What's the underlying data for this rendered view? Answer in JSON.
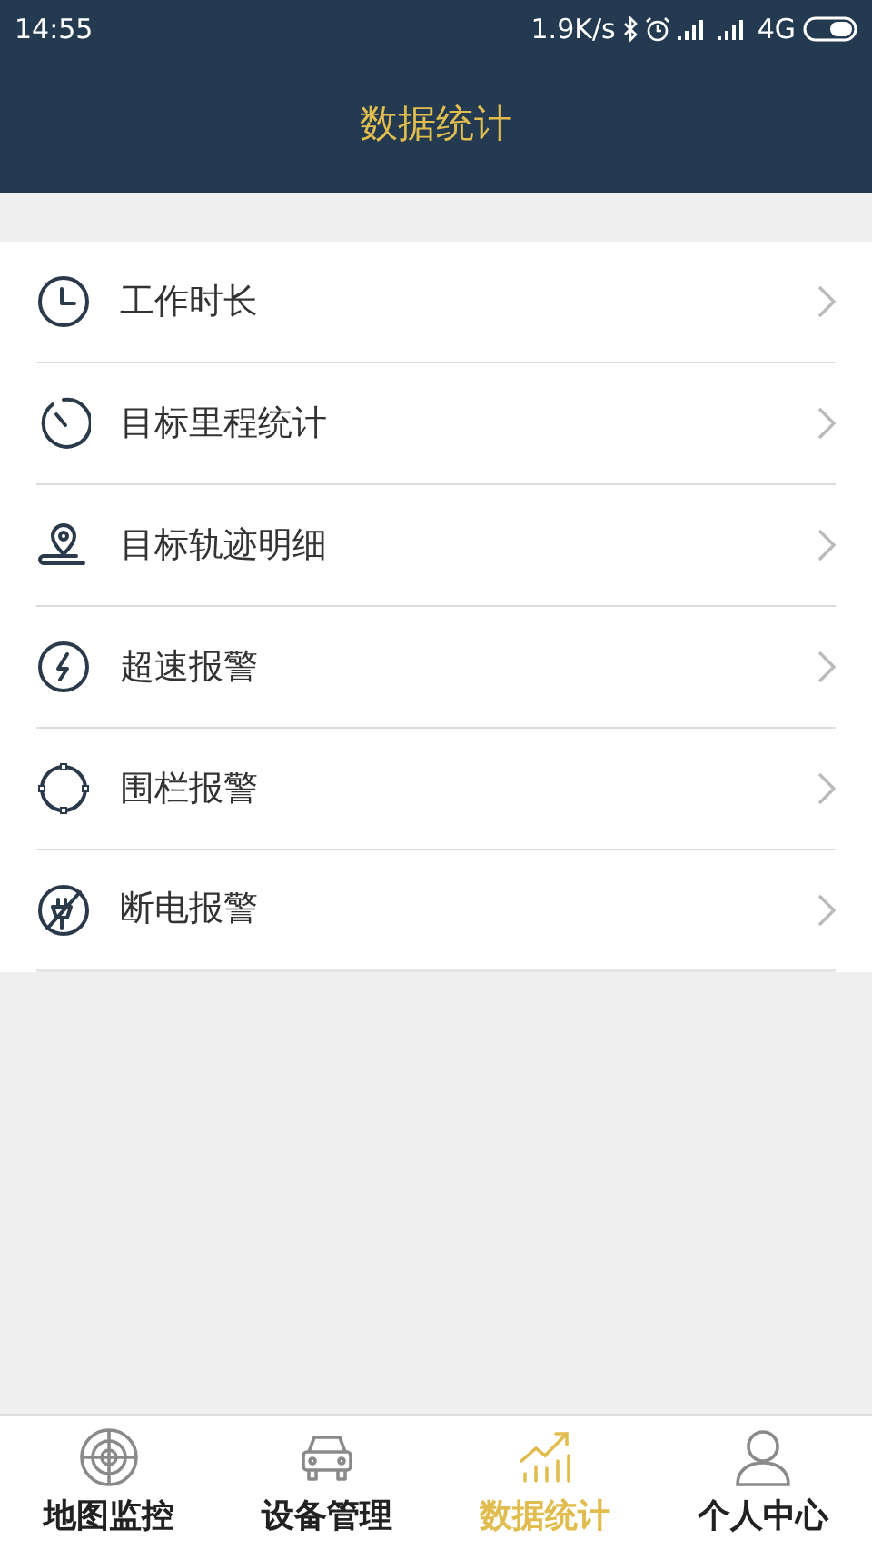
{
  "status_bar": {
    "time": "14:55",
    "network_speed": "1.9K/s",
    "network_type": "4G"
  },
  "header": {
    "title": "数据统计"
  },
  "menu_items": [
    {
      "label": "工作时长"
    },
    {
      "label": "目标里程统计"
    },
    {
      "label": "目标轨迹明细"
    },
    {
      "label": "超速报警"
    },
    {
      "label": "围栏报警"
    },
    {
      "label": "断电报警"
    }
  ],
  "tab_bar": [
    {
      "label": "地图监控",
      "selected": false
    },
    {
      "label": "设备管理",
      "selected": false
    },
    {
      "label": "数据统计",
      "selected": true
    },
    {
      "label": "个人中心",
      "selected": false
    }
  ]
}
